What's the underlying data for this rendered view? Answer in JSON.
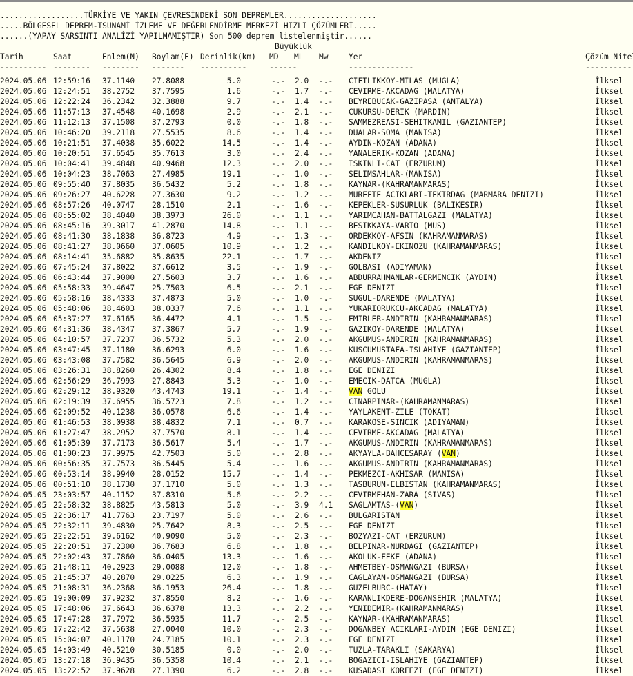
{
  "header": {
    "line1": "..................TÜRKİYE VE YAKIN ÇEVRESİNDEKİ SON DEPREMLER....................",
    "line2": ".....BÖLGESEL DEPREM-TSUNAMİ İZLEME VE DEĞERLENDİRME MERKEZİ HIZLI ÇÖZÜMLERİ.....",
    "line3": "......(YAPAY SARSINTI ANALİZİ YAPILMAMIŞTIR) Son 500 deprem listelenmiştir......"
  },
  "columns": {
    "magnitude_group": "Büyüklük",
    "tarih": "Tarih",
    "saat": "Saat",
    "enlem": "Enlem(N)",
    "boylam": "Boylam(E)",
    "derinlik": "Derinlik(km)",
    "md": "MD",
    "ml": "ML",
    "mw": "Mw",
    "yer": "Yer",
    "cozum": "Çözüm Niteliği"
  },
  "rules": {
    "tarih": "----------",
    "saat": "--------",
    "enlem": "--------",
    "boylam": "-------",
    "derinlik": "----------",
    "md": "------",
    "ml": "",
    "mw": "",
    "yer": "--------------",
    "cozum": "------------"
  },
  "highlight_term": "VAN",
  "rows": [
    [
      "2024.05.06",
      "12:59:16",
      "37.1140",
      "27.8088",
      "5.0",
      "-.-",
      "2.0",
      "-.-",
      "CIFTLIKKOY-MILAS (MUGLA)",
      "İlksel"
    ],
    [
      "2024.05.06",
      "12:24:51",
      "38.2752",
      "37.7595",
      "1.6",
      "-.-",
      "1.7",
      "-.-",
      "CEVIRME-AKCADAG (MALATYA)",
      "İlksel"
    ],
    [
      "2024.05.06",
      "12:22:24",
      "36.2342",
      "32.3888",
      "9.7",
      "-.-",
      "1.4",
      "-.-",
      "BEYREBUCAK-GAZIPASA (ANTALYA)",
      "İlksel"
    ],
    [
      "2024.05.06",
      "11:57:13",
      "37.4548",
      "40.1698",
      "2.9",
      "-.-",
      "2.1",
      "-.-",
      "CUKURSU-DERIK (MARDIN)",
      "İlksel"
    ],
    [
      "2024.05.06",
      "11:12:13",
      "37.1508",
      "37.2793",
      "0.0",
      "-.-",
      "1.8",
      "-.-",
      "SAMMEZREASI-SEHITKAMIL (GAZIANTEP)",
      "İlksel"
    ],
    [
      "2024.05.06",
      "10:46:20",
      "39.2118",
      "27.5535",
      "8.6",
      "-.-",
      "1.4",
      "-.-",
      "DUALAR-SOMA (MANISA)",
      "İlksel"
    ],
    [
      "2024.05.06",
      "10:21:51",
      "37.4038",
      "35.6022",
      "14.5",
      "-.-",
      "1.4",
      "-.-",
      "AYDIN-KOZAN (ADANA)",
      "İlksel"
    ],
    [
      "2024.05.06",
      "10:20:51",
      "37.6545",
      "35.7613",
      "3.0",
      "-.-",
      "2.4",
      "-.-",
      "YANALERIK-KOZAN (ADANA)",
      "İlksel"
    ],
    [
      "2024.05.06",
      "10:04:41",
      "39.4848",
      "40.9468",
      "12.3",
      "-.-",
      "2.0",
      "-.-",
      "ISKINLI-CAT (ERZURUM)",
      "İlksel"
    ],
    [
      "2024.05.06",
      "10:04:23",
      "38.7063",
      "27.4985",
      "19.1",
      "-.-",
      "1.0",
      "-.-",
      "SELIMSAHLAR-(MANISA)",
      "İlksel"
    ],
    [
      "2024.05.06",
      "09:55:40",
      "37.8035",
      "36.5432",
      "5.2",
      "-.-",
      "1.8",
      "-.-",
      "KAYNAR-(KAHRAMANMARAS)",
      "İlksel"
    ],
    [
      "2024.05.06",
      "09:26:27",
      "40.6228",
      "27.3630",
      "9.2",
      "-.-",
      "1.2",
      "-.-",
      "MUREFTE ACIKLARI-TEKIRDAG (MARMARA DENIZI)",
      "İlksel"
    ],
    [
      "2024.05.06",
      "08:57:26",
      "40.0747",
      "28.1510",
      "2.1",
      "-.-",
      "1.6",
      "-.-",
      "KEPEKLER-SUSURLUK (BALIKESIR)",
      "İlksel"
    ],
    [
      "2024.05.06",
      "08:55:02",
      "38.4040",
      "38.3973",
      "26.0",
      "-.-",
      "1.1",
      "-.-",
      "YARIMCAHAN-BATTALGAZI (MALATYA)",
      "İlksel"
    ],
    [
      "2024.05.06",
      "08:45:16",
      "39.3017",
      "41.2870",
      "14.8",
      "-.-",
      "1.1",
      "-.-",
      "BESIKKAYA-VARTO (MUS)",
      "İlksel"
    ],
    [
      "2024.05.06",
      "08:41:30",
      "38.1838",
      "36.8723",
      "4.9",
      "-.-",
      "1.3",
      "-.-",
      "ORDEKKOY-AFSIN (KAHRAMANMARAS)",
      "İlksel"
    ],
    [
      "2024.05.06",
      "08:41:27",
      "38.0660",
      "37.0605",
      "10.9",
      "-.-",
      "1.2",
      "-.-",
      "KANDILKOY-EKINOZU (KAHRAMANMARAS)",
      "İlksel"
    ],
    [
      "2024.05.06",
      "08:14:41",
      "35.6882",
      "35.8635",
      "22.1",
      "-.-",
      "1.7",
      "-.-",
      "AKDENIZ",
      "İlksel"
    ],
    [
      "2024.05.06",
      "07:45:24",
      "37.8022",
      "37.6612",
      "3.5",
      "-.-",
      "1.9",
      "-.-",
      "GOLBASI (ADIYAMAN)",
      "İlksel"
    ],
    [
      "2024.05.06",
      "06:43:44",
      "37.9000",
      "27.5603",
      "3.7",
      "-.-",
      "1.6",
      "-.-",
      "ABDURRAHMANLAR-GERMENCIK (AYDIN)",
      "İlksel"
    ],
    [
      "2024.05.06",
      "05:58:33",
      "39.4647",
      "25.7503",
      "6.5",
      "-.-",
      "2.1",
      "-.-",
      "EGE DENIZI",
      "İlksel"
    ],
    [
      "2024.05.06",
      "05:58:16",
      "38.4333",
      "37.4873",
      "5.0",
      "-.-",
      "1.0",
      "-.-",
      "SUGUL-DARENDE (MALATYA)",
      "İlksel"
    ],
    [
      "2024.05.06",
      "05:48:06",
      "38.4603",
      "38.0337",
      "7.6",
      "-.-",
      "1.1",
      "-.-",
      "YUKARIORUKCU-AKCADAG (MALATYA)",
      "İlksel"
    ],
    [
      "2024.05.06",
      "05:37:27",
      "37.6165",
      "36.4472",
      "4.1",
      "-.-",
      "1.5",
      "-.-",
      "EMIRLER-ANDIRIN (KAHRAMANMARAS)",
      "İlksel"
    ],
    [
      "2024.05.06",
      "04:31:36",
      "38.4347",
      "37.3867",
      "5.7",
      "-.-",
      "1.9",
      "-.-",
      "GAZIKOY-DARENDE (MALATYA)",
      "İlksel"
    ],
    [
      "2024.05.06",
      "04:10:57",
      "37.7237",
      "36.5732",
      "5.3",
      "-.-",
      "2.0",
      "-.-",
      "AKGUMUS-ANDIRIN (KAHRAMANMARAS)",
      "İlksel"
    ],
    [
      "2024.05.06",
      "03:47:45",
      "37.1180",
      "36.6293",
      "6.0",
      "-.-",
      "1.6",
      "-.-",
      "KUSCUMUSTAFA-ISLAHIYE (GAZIANTEP)",
      "İlksel"
    ],
    [
      "2024.05.06",
      "03:43:08",
      "37.7582",
      "36.5645",
      "6.9",
      "-.-",
      "2.0",
      "-.-",
      "AKGUMUS-ANDIRIN (KAHRAMANMARAS)",
      "İlksel"
    ],
    [
      "2024.05.06",
      "03:26:31",
      "38.8260",
      "26.4302",
      "8.4",
      "-.-",
      "1.8",
      "-.-",
      "EGE DENIZI",
      "İlksel"
    ],
    [
      "2024.05.06",
      "02:56:29",
      "36.7993",
      "27.8843",
      "5.3",
      "-.-",
      "1.0",
      "-.-",
      "EMECIK-DATCA (MUGLA)",
      "İlksel"
    ],
    [
      "2024.05.06",
      "02:29:12",
      "38.9320",
      "43.4743",
      "19.1",
      "-.-",
      "1.4",
      "-.-",
      "VAN GOLU",
      "İlksel"
    ],
    [
      "2024.05.06",
      "02:19:39",
      "37.6955",
      "36.5723",
      "7.8",
      "-.-",
      "1.2",
      "-.-",
      "CINARPINAR-(KAHRAMANMARAS)",
      "İlksel"
    ],
    [
      "2024.05.06",
      "02:09:52",
      "40.1238",
      "36.0578",
      "6.6",
      "-.-",
      "1.4",
      "-.-",
      "YAYLAKENT-ZILE (TOKAT)",
      "İlksel"
    ],
    [
      "2024.05.06",
      "01:46:53",
      "38.0938",
      "38.4832",
      "7.1",
      "-.-",
      "0.7",
      "-.-",
      "KARAKOSE-SINCIK (ADIYAMAN)",
      "İlksel"
    ],
    [
      "2024.05.06",
      "01:27:47",
      "38.2952",
      "37.7570",
      "8.1",
      "-.-",
      "1.4",
      "-.-",
      "CEVIRME-AKCADAG (MALATYA)",
      "İlksel"
    ],
    [
      "2024.05.06",
      "01:05:39",
      "37.7173",
      "36.5617",
      "5.4",
      "-.-",
      "1.7",
      "-.-",
      "AKGUMUS-ANDIRIN (KAHRAMANMARAS)",
      "İlksel"
    ],
    [
      "2024.05.06",
      "01:00:23",
      "37.9975",
      "42.7503",
      "5.0",
      "-.-",
      "2.8",
      "-.-",
      "AKYAYLA-BAHCESARAY (VAN)",
      "İlksel"
    ],
    [
      "2024.05.06",
      "00:56:35",
      "37.7573",
      "36.5445",
      "5.4",
      "-.-",
      "1.6",
      "-.-",
      "AKGUMUS-ANDIRIN (KAHRAMANMARAS)",
      "İlksel"
    ],
    [
      "2024.05.06",
      "00:53:14",
      "38.9940",
      "28.0152",
      "15.7",
      "-.-",
      "1.4",
      "-.-",
      "PEKMEZCI-AKHISAR (MANISA)",
      "İlksel"
    ],
    [
      "2024.05.06",
      "00:51:10",
      "38.1730",
      "37.1710",
      "5.0",
      "-.-",
      "1.3",
      "-.-",
      "TASBURUN-ELBISTAN (KAHRAMANMARAS)",
      "İlksel"
    ],
    [
      "2024.05.05",
      "23:03:57",
      "40.1152",
      "37.8310",
      "5.6",
      "-.-",
      "2.2",
      "-.-",
      "CEVIRMEHAN-ZARA (SIVAS)",
      "İlksel"
    ],
    [
      "2024.05.05",
      "22:58:32",
      "38.8825",
      "43.5813",
      "5.0",
      "-.-",
      "3.9",
      "4.1",
      "SAGLAMTAS-(VAN)",
      "İlksel"
    ],
    [
      "2024.05.05",
      "22:36:17",
      "41.7763",
      "23.7197",
      "5.0",
      "-.-",
      "2.6",
      "-.-",
      "BULGARISTAN",
      "İlksel"
    ],
    [
      "2024.05.05",
      "22:32:11",
      "39.4830",
      "25.7642",
      "8.3",
      "-.-",
      "2.5",
      "-.-",
      "EGE DENIZI",
      "İlksel"
    ],
    [
      "2024.05.05",
      "22:22:51",
      "39.6162",
      "40.9090",
      "5.0",
      "-.-",
      "2.3",
      "-.-",
      "BOZYAZI-CAT (ERZURUM)",
      "İlksel"
    ],
    [
      "2024.05.05",
      "22:20:51",
      "37.2300",
      "36.7683",
      "6.8",
      "-.-",
      "1.8",
      "-.-",
      "BELPINAR-NURDAGI (GAZIANTEP)",
      "İlksel"
    ],
    [
      "2024.05.05",
      "22:02:43",
      "37.7860",
      "36.0405",
      "13.3",
      "-.-",
      "1.6",
      "-.-",
      "AKOLUK-FEKE (ADANA)",
      "İlksel"
    ],
    [
      "2024.05.05",
      "21:48:11",
      "40.2923",
      "29.0088",
      "12.0",
      "-.-",
      "1.8",
      "-.-",
      "AHMETBEY-OSMANGAZI (BURSA)",
      "İlksel"
    ],
    [
      "2024.05.05",
      "21:45:37",
      "40.2870",
      "29.0225",
      "6.3",
      "-.-",
      "1.9",
      "-.-",
      "CAGLAYAN-OSMANGAZI (BURSA)",
      "İlksel"
    ],
    [
      "2024.05.05",
      "21:08:31",
      "36.2368",
      "36.1953",
      "26.4",
      "-.-",
      "1.8",
      "-.-",
      "GUZELBURC-(HATAY)",
      "İlksel"
    ],
    [
      "2024.05.05",
      "19:00:09",
      "37.9232",
      "37.8550",
      "8.2",
      "-.-",
      "1.6",
      "-.-",
      "KARANLIKDERE-DOGANSEHIR (MALATYA)",
      "İlksel"
    ],
    [
      "2024.05.05",
      "17:48:06",
      "37.6643",
      "36.6378",
      "13.3",
      "-.-",
      "2.2",
      "-.-",
      "YENIDEMIR-(KAHRAMANMARAS)",
      "İlksel"
    ],
    [
      "2024.05.05",
      "17:47:28",
      "37.7972",
      "36.5935",
      "11.7",
      "-.-",
      "2.5",
      "-.-",
      "KAYNAR-(KAHRAMANMARAS)",
      "İlksel"
    ],
    [
      "2024.05.05",
      "17:22:42",
      "37.5638",
      "27.0040",
      "10.0",
      "-.-",
      "2.3",
      "-.-",
      "DOGANBEY ACIKLARI-AYDIN (EGE DENIZI)",
      "İlksel"
    ],
    [
      "2024.05.05",
      "15:04:07",
      "40.1170",
      "24.7185",
      "10.1",
      "-.-",
      "2.3",
      "-.-",
      "EGE DENIZI",
      "İlksel"
    ],
    [
      "2024.05.05",
      "14:03:49",
      "40.5210",
      "30.5185",
      "0.0",
      "-.-",
      "2.0",
      "-.-",
      "TUZLA-TARAKLI (SAKARYA)",
      "İlksel"
    ],
    [
      "2024.05.05",
      "13:27:18",
      "36.9435",
      "36.5358",
      "10.4",
      "-.-",
      "2.1",
      "-.-",
      "BOGAZICI-ISLAHIYE (GAZIANTEP)",
      "İlksel"
    ],
    [
      "2024.05.05",
      "13:22:52",
      "37.9628",
      "27.1390",
      "6.2",
      "-.-",
      "2.8",
      "-.-",
      "KUSADASI KORFEZI (EGE DENIZI)",
      "İlksel"
    ]
  ]
}
